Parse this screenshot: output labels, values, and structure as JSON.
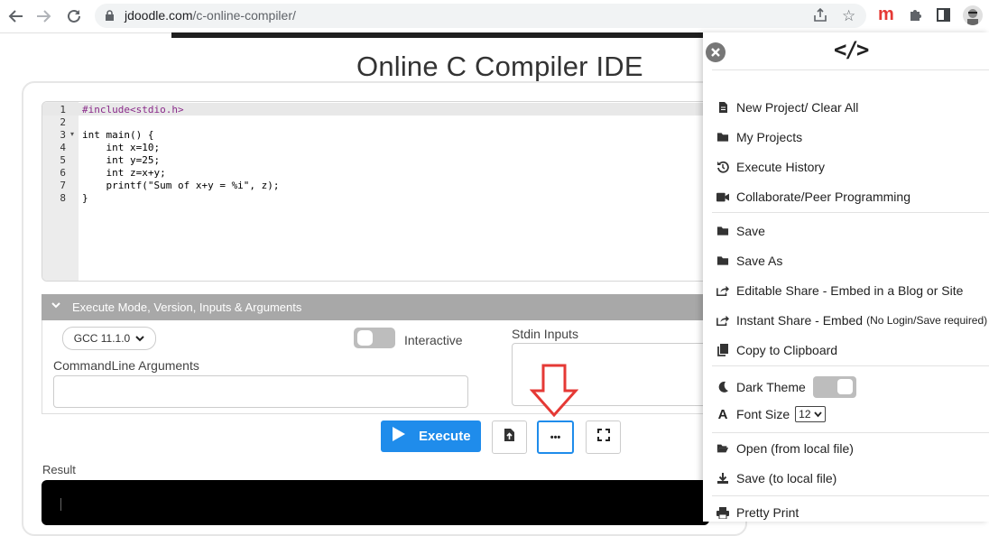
{
  "browser": {
    "url_host": "jdoodle.com",
    "url_path": "/c-online-compiler/"
  },
  "page": {
    "title": "Online C Compiler IDE"
  },
  "editor": {
    "lines": [
      "#include<stdio.h>",
      "",
      "int main() {",
      "    int x=10;",
      "    int y=25;",
      "    int z=x+y;",
      "    printf(\"Sum of x+y = %i\", z);",
      "}"
    ]
  },
  "execute_panel": {
    "header": "Execute Mode, Version, Inputs & Arguments",
    "version": "GCC 11.1.0",
    "interactive_label": "Interactive",
    "stdin_label": "Stdin Inputs",
    "cmdline_label": "CommandLine Arguments",
    "execute_label": "Execute",
    "more_label": "•••",
    "result_label": "Result"
  },
  "sidebar": {
    "logo": "</>",
    "items": [
      {
        "label": "New Project/ Clear All",
        "icon": "file-icon"
      },
      {
        "label": "My Projects",
        "icon": "folder-icon"
      },
      {
        "label": "Execute History",
        "icon": "history-icon"
      },
      {
        "label": "Collaborate/Peer Programming",
        "icon": "video-icon"
      },
      {
        "label": "Save",
        "icon": "folder-icon"
      },
      {
        "label": "Save As",
        "icon": "folder-icon"
      },
      {
        "label": "Editable Share - Embed in a Blog or Site",
        "icon": "share-icon"
      },
      {
        "label": "Instant Share - Embed",
        "note": "(No Login/Save required)",
        "icon": "share-icon"
      },
      {
        "label": "Copy to Clipboard",
        "icon": "copy-icon"
      },
      {
        "label": "Dark Theme",
        "icon": "moon-icon"
      },
      {
        "label": "Font Size",
        "icon": "font-icon",
        "value": "12"
      },
      {
        "label": "Open (from local file)",
        "icon": "folder-open-icon"
      },
      {
        "label": "Save (to local file)",
        "icon": "download-icon"
      },
      {
        "label": "Pretty Print",
        "icon": "print-icon"
      }
    ]
  },
  "colors": {
    "execute": "#1f8ceb",
    "arrow": "#e53935",
    "mode_bar": "#a8a8a8"
  }
}
